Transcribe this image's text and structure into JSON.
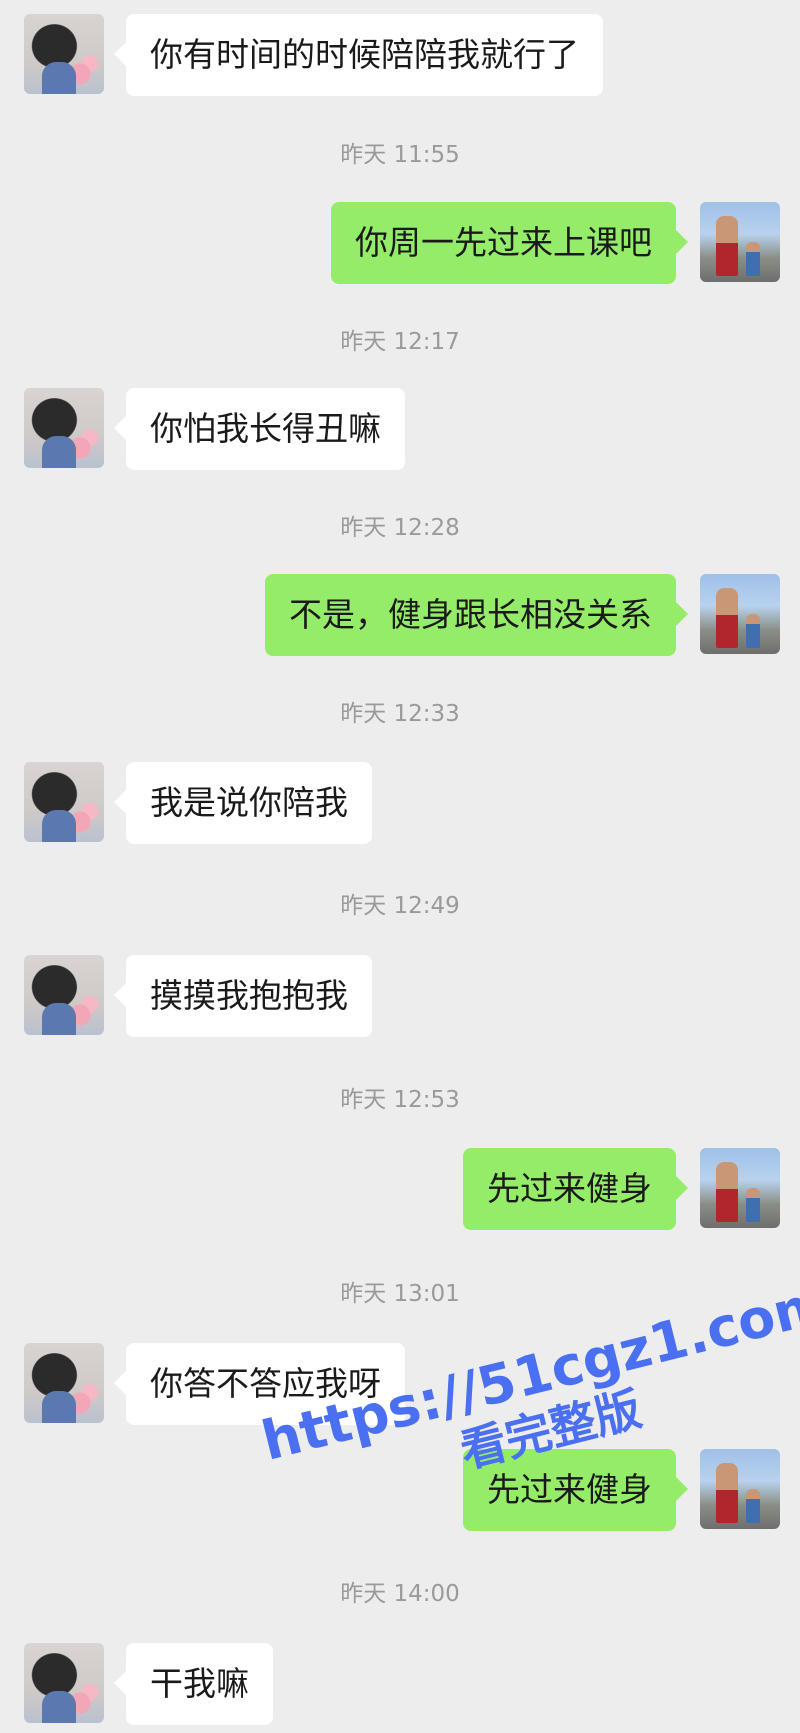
{
  "messages": [
    {
      "side": "in",
      "text": "你有时间的时候陪陪我就行了"
    },
    {
      "time": "昨天 11:55"
    },
    {
      "side": "out",
      "text": "你周一先过来上课吧"
    },
    {
      "time": "昨天 12:17"
    },
    {
      "side": "in",
      "text": "你怕我长得丑嘛"
    },
    {
      "time": "昨天 12:28"
    },
    {
      "side": "out",
      "text": "不是，健身跟长相没关系"
    },
    {
      "time": "昨天 12:33"
    },
    {
      "side": "in",
      "text": "我是说你陪我"
    },
    {
      "time": "昨天 12:49"
    },
    {
      "side": "in",
      "text": "摸摸我抱抱我"
    },
    {
      "time": "昨天 12:53"
    },
    {
      "side": "out",
      "text": "先过来健身"
    },
    {
      "time": "昨天 13:01"
    },
    {
      "side": "in",
      "text": "你答不答应我呀"
    },
    {
      "side": "out",
      "text": "先过来健身"
    },
    {
      "time": "昨天 14:00"
    },
    {
      "side": "in",
      "text": "干我嘛"
    }
  ],
  "watermark": {
    "url": "https://51cgz1.com",
    "subtitle": "看完整版"
  },
  "colors": {
    "background": "#ededed",
    "incoming_bubble": "#ffffff",
    "outgoing_bubble": "#95ec69",
    "watermark": "#4a6ff0"
  }
}
